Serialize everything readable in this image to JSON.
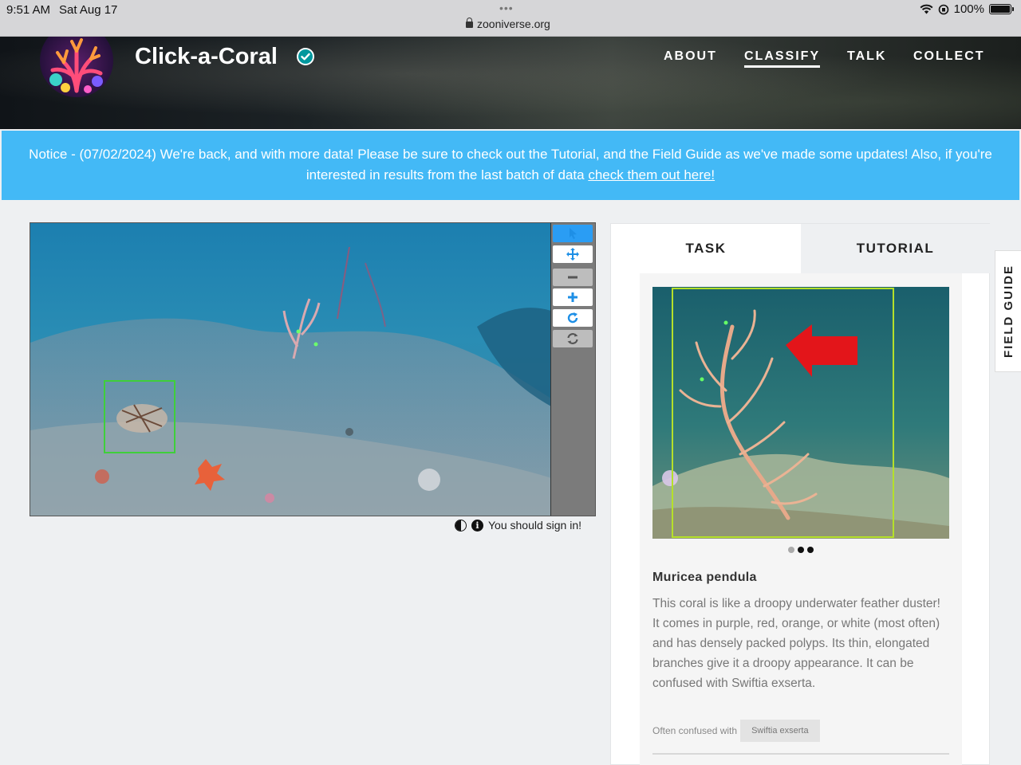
{
  "status_bar": {
    "time": "9:51 AM",
    "date": "Sat Aug 17",
    "url": "zooniverse.org",
    "battery": "100%"
  },
  "header": {
    "project_title": "Click-a-Coral",
    "nav": [
      {
        "label": "ABOUT",
        "active": false
      },
      {
        "label": "CLASSIFY",
        "active": true
      },
      {
        "label": "TALK",
        "active": false
      },
      {
        "label": "COLLECT",
        "active": false
      }
    ]
  },
  "notice": {
    "text": "Notice - (07/02/2024) We're back, and with more data! Please be sure to check out the Tutorial, and the Field Guide as we've made some updates! Also, if you're interested in results from the last batch of data ",
    "link": "check them out here!"
  },
  "viewer": {
    "tools": [
      "pointer-icon",
      "move-icon",
      "zoom-out-icon",
      "zoom-in-icon",
      "rotate-icon",
      "reset-icon"
    ],
    "signin_text": "You should sign in!"
  },
  "panel": {
    "tabs": {
      "task": "TASK",
      "tutorial": "TUTORIAL"
    },
    "carousel": {
      "total": 3,
      "active": 2
    },
    "species": "Muricea pendula",
    "description": "This coral is like a droopy underwater feather duster! It comes in purple, red, orange, or white (most often) and has densely packed polyps. Its thin, elongated branches give it a droopy appearance. It can be confused with Swiftia exserta.",
    "confused_label": "Often confused with",
    "confused_with": "Swiftia exserta"
  },
  "field_guide_label": "FIELD GUIDE",
  "colors": {
    "notice_bg": "#43b9f6",
    "tool_active": "#2a9df4",
    "box_green": "#3fcf3a",
    "box_lime": "#b5e02a",
    "arrow_red": "#e3151a"
  }
}
